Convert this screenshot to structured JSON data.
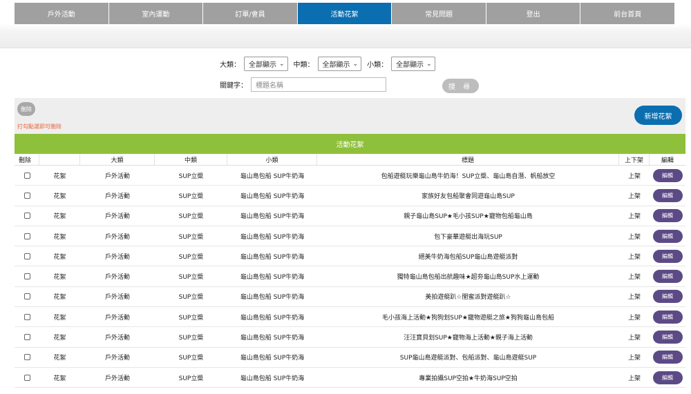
{
  "nav": {
    "items": [
      {
        "label": "戶外活動",
        "active": false
      },
      {
        "label": "室內運動",
        "active": false
      },
      {
        "label": "訂單/會員",
        "active": false
      },
      {
        "label": "活動花絮",
        "active": true
      },
      {
        "label": "常見問題",
        "active": false
      },
      {
        "label": "登出",
        "active": false
      },
      {
        "label": "前台首頁",
        "active": false
      }
    ]
  },
  "filters": {
    "category_label": "大類：",
    "category_value": "全部顯示",
    "mid_label": "中類：",
    "mid_value": "全部顯示",
    "small_label": "小類：",
    "small_value": "全部顯示",
    "keyword_label": "關鍵字：",
    "keyword_placeholder": "標題名稱",
    "search_label": "搜 尋"
  },
  "toolbar": {
    "delete_label": "刪除",
    "delete_hint": "打勾點選即可刪除",
    "add_label": "新增花絮"
  },
  "banner": {
    "title": "活動花絮"
  },
  "table": {
    "headers": [
      "刪除",
      "",
      "大類",
      "中類",
      "小類",
      "標題",
      "上下架",
      "編輯"
    ],
    "rows": [
      {
        "type": "花絮",
        "category": "戶外活動",
        "mid": "SUP立槳",
        "small": "龜山島包船 SUP牛奶海",
        "title": "包船遊艇玩樂龜山島牛奶海！SUP立槳、龜山島自潛、帆船放空",
        "status": "上架",
        "edit": "編輯"
      },
      {
        "type": "花絮",
        "category": "戶外活動",
        "mid": "SUP立槳",
        "small": "龜山島包船 SUP牛奶海",
        "title": "家族好友包船聚會同遊龜山島SUP",
        "status": "上架",
        "edit": "編輯"
      },
      {
        "type": "花絮",
        "category": "戶外活動",
        "mid": "SUP立槳",
        "small": "龜山島包船 SUP牛奶海",
        "title": "親子龜山島SUP★毛小孩SUP★寵物包船龜山島",
        "status": "上架",
        "edit": "編輯"
      },
      {
        "type": "花絮",
        "category": "戶外活動",
        "mid": "SUP立槳",
        "small": "龜山島包船 SUP牛奶海",
        "title": "包下豪華遊艇出海玩SUP",
        "status": "上架",
        "edit": "編輯"
      },
      {
        "type": "花絮",
        "category": "戶外活動",
        "mid": "SUP立槳",
        "small": "龜山島包船 SUP牛奶海",
        "title": "絕美牛奶海包船SUP龜山島遊艇派對",
        "status": "上架",
        "edit": "編輯"
      },
      {
        "type": "花絮",
        "category": "戶外活動",
        "mid": "SUP立槳",
        "small": "龜山島包船 SUP牛奶海",
        "title": "獨特龜山島包船出航趣味★超夯龜山島SUP水上運動",
        "status": "上架",
        "edit": "編輯"
      },
      {
        "type": "花絮",
        "category": "戶外活動",
        "mid": "SUP立槳",
        "small": "龜山島包船 SUP牛奶海",
        "title": "美拍遊艇趴☆閨蜜派對遊艇趴☆",
        "status": "上架",
        "edit": "編輯"
      },
      {
        "type": "花絮",
        "category": "戶外活動",
        "mid": "SUP立槳",
        "small": "龜山島包船 SUP牛奶海",
        "title": "毛小孩海上活動★狗狗划SUP★寵物遊艇之旅★狗狗龜山島包船",
        "status": "上架",
        "edit": "編輯"
      },
      {
        "type": "花絮",
        "category": "戶外活動",
        "mid": "SUP立槳",
        "small": "龜山島包船 SUP牛奶海",
        "title": "汪汪寶貝划SUP★寵物海上活動★親子海上活動",
        "status": "上架",
        "edit": "編輯"
      },
      {
        "type": "花絮",
        "category": "戶外活動",
        "mid": "SUP立槳",
        "small": "龜山島包船 SUP牛奶海",
        "title": "SUP龜山島遊艇派對、包船派對、龜山島遊艇SUP",
        "status": "上架",
        "edit": "編輯"
      },
      {
        "type": "花絮",
        "category": "戶外活動",
        "mid": "SUP立槳",
        "small": "龜山島包船 SUP牛奶海",
        "title": "專業拍攝SUP空拍★牛奶海SUP空拍",
        "status": "上架",
        "edit": "編輯"
      }
    ]
  },
  "colors": {
    "nav_active": "#0a6eb0",
    "nav_default": "#a0a0a0",
    "banner": "#8fc03b",
    "edit_button": "#5c4a86",
    "hint_text": "#e8653a"
  }
}
